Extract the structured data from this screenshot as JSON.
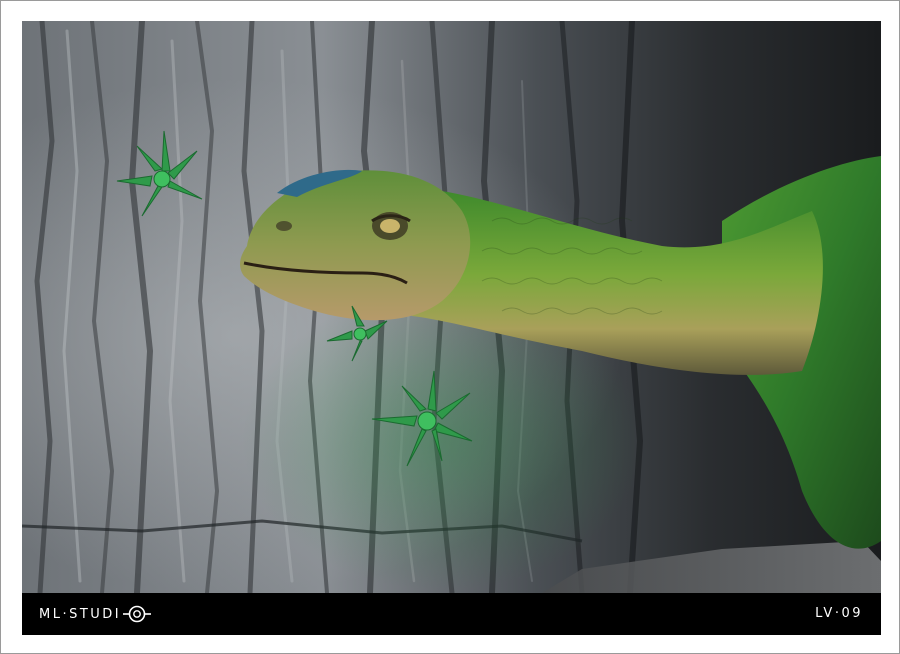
{
  "footer": {
    "brand_text": "ML·STUDI",
    "brand_logo_icon": "camera-aperture-o-icon",
    "code": "LV·09"
  },
  "colors": {
    "frame_border": "#9a9a9a",
    "caption_bar": "#000000",
    "caption_text": "#ffffff"
  }
}
